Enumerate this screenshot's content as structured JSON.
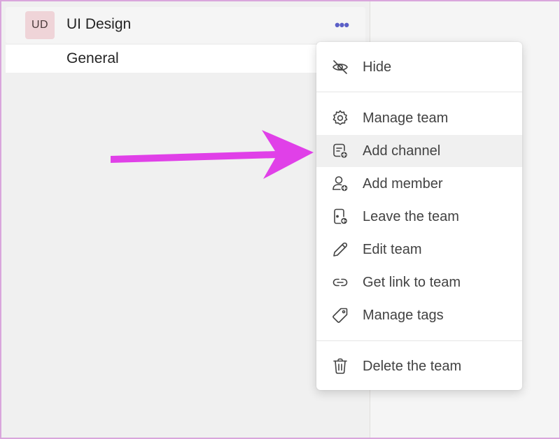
{
  "team": {
    "avatar_initials": "UD",
    "avatar_color": "#efd4d8",
    "name": "UI Design",
    "more_label": "•••"
  },
  "channel": {
    "name": "General"
  },
  "menu": {
    "items": [
      {
        "label": "Hide",
        "icon": "hide-icon"
      },
      {
        "label": "Manage team",
        "icon": "gear-icon"
      },
      {
        "label": "Add channel",
        "icon": "add-channel-icon",
        "highlighted": true
      },
      {
        "label": "Add member",
        "icon": "add-member-icon"
      },
      {
        "label": "Leave the team",
        "icon": "leave-icon"
      },
      {
        "label": "Edit team",
        "icon": "pencil-icon"
      },
      {
        "label": "Get link to team",
        "icon": "link-icon"
      },
      {
        "label": "Manage tags",
        "icon": "tag-icon"
      },
      {
        "label": "Delete the team",
        "icon": "trash-icon"
      }
    ]
  },
  "annotation": {
    "arrow_color": "#e040e8",
    "points_to": "Add channel"
  }
}
